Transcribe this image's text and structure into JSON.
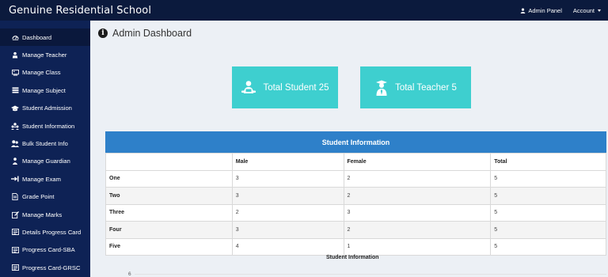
{
  "app": {
    "title": "Genuine Residential School"
  },
  "topnav": {
    "admin_panel": "Admin Panel",
    "account": "Account"
  },
  "sidebar": {
    "items": [
      {
        "label": "Dashboard",
        "icon": "dashboard-icon",
        "active": true
      },
      {
        "label": "Manage Teacher",
        "icon": "teacher-icon"
      },
      {
        "label": "Manage Class",
        "icon": "class-icon"
      },
      {
        "label": "Manage Subject",
        "icon": "subject-icon"
      },
      {
        "label": "Student Admission",
        "icon": "graduation-cap-icon"
      },
      {
        "label": "Student Information",
        "icon": "users-icon"
      },
      {
        "label": "Bulk Student Info",
        "icon": "group-icon"
      },
      {
        "label": "Manage Guardian",
        "icon": "guardian-icon"
      },
      {
        "label": "Manage Exam",
        "icon": "exam-icon"
      },
      {
        "label": "Grade Point",
        "icon": "grade-icon"
      },
      {
        "label": "Manage Marks",
        "icon": "marks-icon"
      },
      {
        "label": "Details Progress Card",
        "icon": "progress-card-icon"
      },
      {
        "label": "Progress Card-SBA",
        "icon": "progress-card-icon"
      },
      {
        "label": "Progress Card-GRSC",
        "icon": "progress-card-icon"
      }
    ]
  },
  "main": {
    "title": "Admin Dashboard",
    "cards": {
      "students": "Total Student 25",
      "teachers": "Total Teacher 5"
    }
  },
  "table": {
    "title": "Student Information",
    "headers": [
      "",
      "Male",
      "Female",
      "Total"
    ],
    "rows": [
      [
        "One",
        "3",
        "2",
        "5"
      ],
      [
        "Two",
        "3",
        "2",
        "5"
      ],
      [
        "Three",
        "2",
        "3",
        "5"
      ],
      [
        "Four",
        "3",
        "2",
        "5"
      ],
      [
        "Five",
        "4",
        "1",
        "5"
      ]
    ]
  },
  "chart": {
    "title": "Student Information",
    "first_tick": "6"
  },
  "colors": {
    "topbar": "#0b1a3d",
    "sidebar": "#0e2255",
    "card": "#3ecfcf",
    "table_header": "#2e80c9"
  }
}
